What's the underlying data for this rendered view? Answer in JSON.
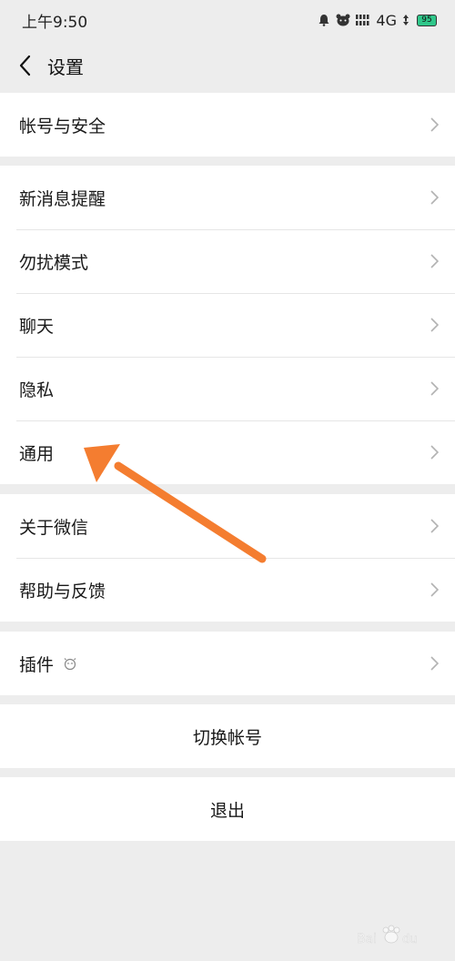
{
  "status_bar": {
    "time": "上午9:50",
    "network": "4G",
    "battery_level": "95"
  },
  "nav": {
    "title": "设置"
  },
  "groups": [
    {
      "items": [
        {
          "label": "帐号与安全"
        }
      ]
    },
    {
      "items": [
        {
          "label": "新消息提醒"
        },
        {
          "label": "勿扰模式"
        },
        {
          "label": "聊天"
        },
        {
          "label": "隐私"
        },
        {
          "label": "通用"
        }
      ]
    },
    {
      "items": [
        {
          "label": "关于微信"
        },
        {
          "label": "帮助与反馈"
        }
      ]
    },
    {
      "items": [
        {
          "label": "插件"
        }
      ]
    }
  ],
  "actions": {
    "switch_account": "切换帐号",
    "logout": "退出"
  },
  "colors": {
    "background": "#ededed",
    "annotation_arrow": "#f47d30"
  },
  "icons": [
    "back-chevron-icon",
    "chevron-right-icon",
    "plugin-icon",
    "signal-icon",
    "battery-icon"
  ]
}
